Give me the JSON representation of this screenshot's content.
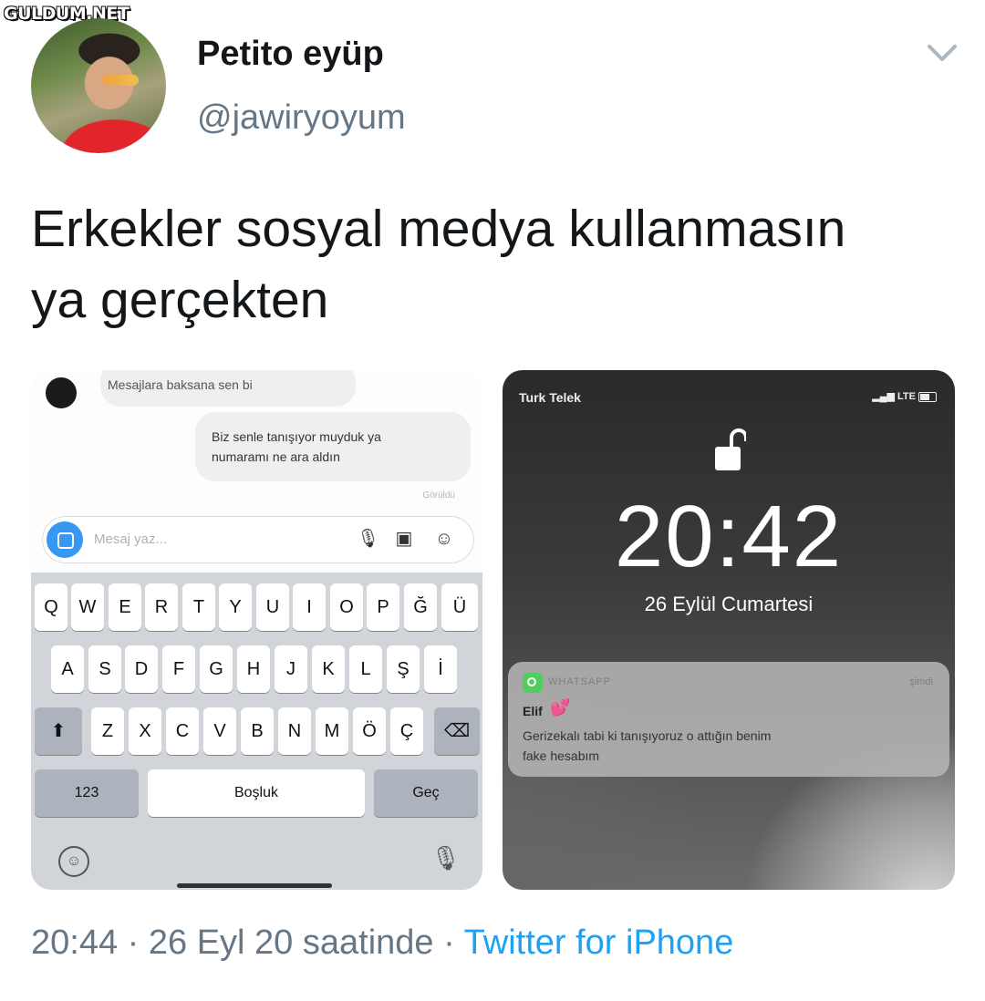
{
  "watermark": "GULDUM.NET",
  "author": {
    "name": "Petito eyüp",
    "handle": "@jawiryoyum"
  },
  "tweet": {
    "text_line1": "Erkekler sosyal medya kullanmasın",
    "text_line2": "ya gerçekten"
  },
  "left_screenshot": {
    "incoming_message": "Mesajlara baksana sen bi",
    "outgoing_message_line1": "Biz senle tanışıyor muyduk ya",
    "outgoing_message_line2": "numaramı ne ara aldın",
    "seen_label": "Görüldü",
    "input_placeholder": "Mesaj yaz...",
    "keyboard": {
      "row1": [
        "Q",
        "W",
        "E",
        "R",
        "T",
        "Y",
        "U",
        "I",
        "O",
        "P",
        "Ğ",
        "Ü"
      ],
      "row2": [
        "A",
        "S",
        "D",
        "F",
        "G",
        "H",
        "J",
        "K",
        "L",
        "Ş",
        "İ"
      ],
      "row3": [
        "Z",
        "X",
        "C",
        "V",
        "B",
        "N",
        "M",
        "Ö",
        "Ç"
      ],
      "numbers_key": "123",
      "space_key": "Boşluk",
      "return_key": "Geç"
    }
  },
  "right_screenshot": {
    "carrier": "Turk Telek",
    "network": "LTE",
    "time": "20:42",
    "date": "26 Eylül Cumartesi",
    "notification": {
      "app": "WHATSAPP",
      "time": "şimdi",
      "sender": "Elif",
      "body_line1": "Gerizekalı tabi ki tanışıyoruz o attığın benim",
      "body_line2": "fake hesabım"
    }
  },
  "meta": {
    "time": "20:44",
    "date": "26 Eyl 20 saatinde",
    "separator": " · ",
    "source": "Twitter for iPhone"
  },
  "colors": {
    "link": "#1da1f2",
    "secondary": "#657786",
    "whatsapp": "#4fce5d"
  }
}
